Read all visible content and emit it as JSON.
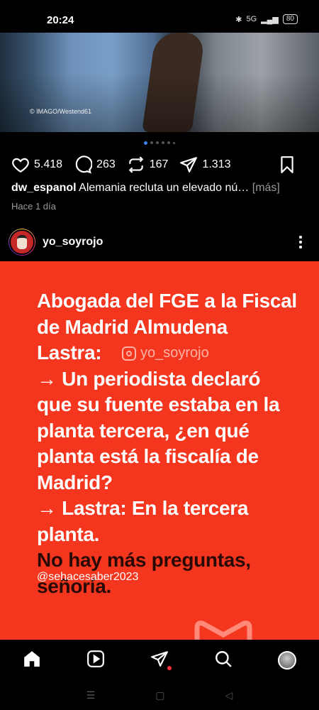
{
  "status": {
    "time": "20:24",
    "network": "5G",
    "battery": "80"
  },
  "post1": {
    "image_credit": "© IMAGO/Westend61",
    "likes": "5.418",
    "comments": "263",
    "reposts": "167",
    "shares": "1.313",
    "username": "dw_espanol",
    "caption": "Alemania recluta un elevado nú…",
    "more": "[más]",
    "time_ago": "Hace 1 día"
  },
  "post2": {
    "username": "yo_soyrojo",
    "watermark": "yo_soyrojo",
    "lines_white": [
      "Abogada del FGE a la Fiscal",
      "de Madrid Almudena",
      "Lastra:",
      " → Un periodista declaró",
      "que su fuente estaba en la",
      "planta tercera, ¿en qué",
      "planta está la fiscalía de",
      "Madrid?",
      "→ Lastra: En la tercera",
      "planta."
    ],
    "lines_dark": [
      "No hay más preguntas,",
      "señoría."
    ],
    "handle": "@sehacesaber2023",
    "bg_color": "#f5361f"
  },
  "tabs": [
    "home-icon",
    "reels-icon",
    "send-icon",
    "search-icon",
    "profile-avatar"
  ]
}
